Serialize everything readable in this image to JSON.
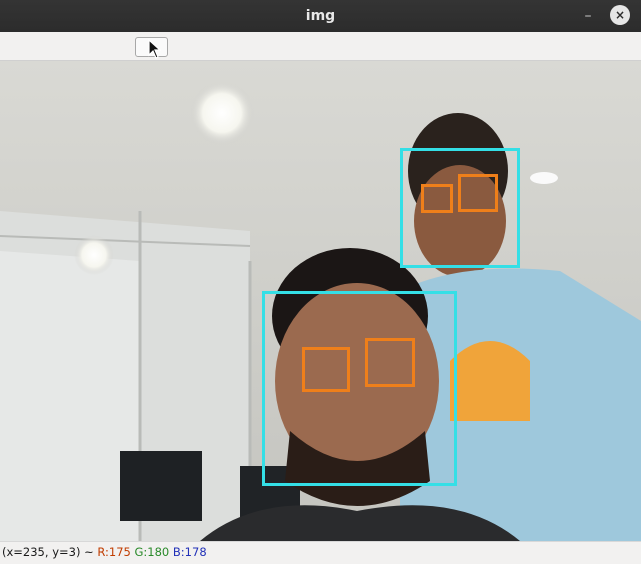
{
  "window": {
    "title": "img",
    "minimize_glyph": "–",
    "close_glyph": "×"
  },
  "toolbar": {
    "button_icon": "blank-tool-icon"
  },
  "image": {
    "description_icon": "webcam-frame",
    "face_box_color": "#34dfe6",
    "eye_box_color": "#ef7f1a",
    "detections": {
      "faces": 2,
      "eyes": 4
    }
  },
  "status": {
    "coords": "(x=235, y=3) ~ ",
    "r": "R:175",
    "g": "G:180",
    "b": "B:178"
  }
}
